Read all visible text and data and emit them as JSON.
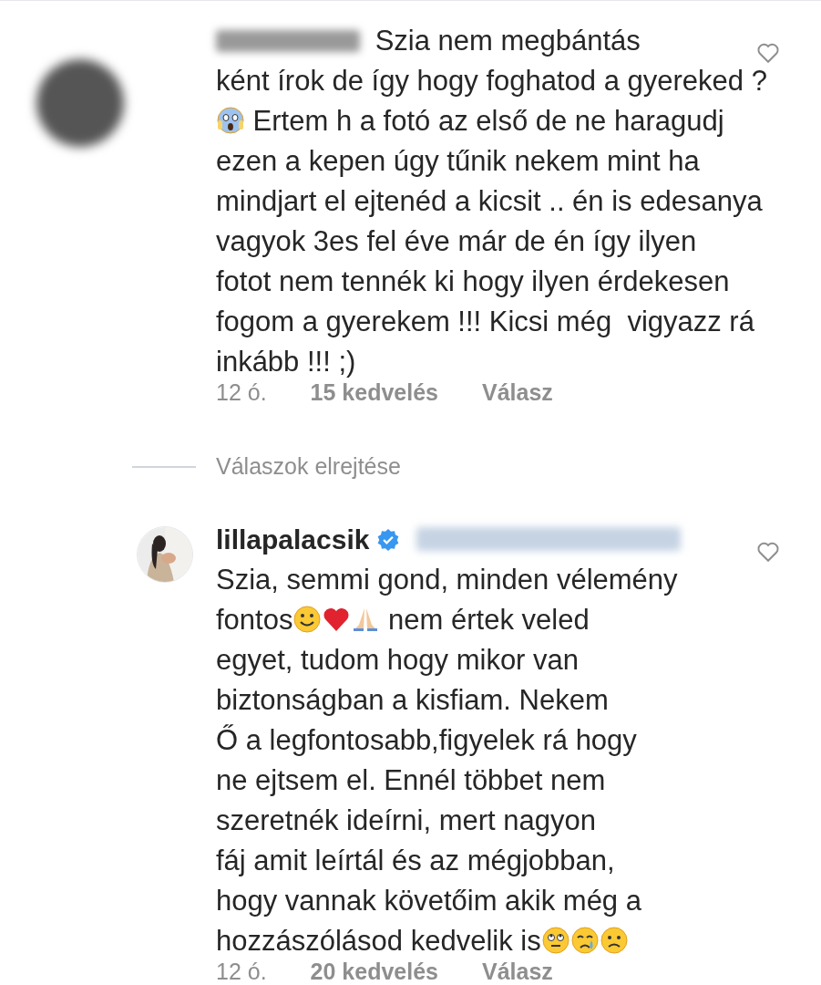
{
  "comments": [
    {
      "avatar_blurred": true,
      "username_blurred": true,
      "verified": false,
      "mention_blurred": false,
      "liked": false,
      "body": [
        {
          "kind": "text",
          "text": "Szia nem megbántás\nként írok de így hogy foghatod a gyereked ?\n"
        },
        {
          "kind": "scream-emoji"
        },
        {
          "kind": "text",
          "text": " Ertem h a fotó az első de ne haragudj\nezen a kepen úgy tűnik nekem mint ha\nmindjart el ejtenéd a kicsit .. én is edesanya\nvagyok 3es fel éve már de én így ilyen\nfotot nem tennék ki hogy ilyen érdekesen\nfogom a gyerekem !!! Kicsi még  vigyazz rá\ninkább !!! ;)"
        }
      ],
      "time": "12 ó.",
      "likes": "15 kedvelés",
      "reply": "Válasz"
    },
    {
      "hide_replies": "Válaszok elrejtése"
    },
    {
      "avatar_blurred": false,
      "username": "lillapalacsik",
      "verified": true,
      "mention_blurred": true,
      "liked": false,
      "body": [
        {
          "kind": "text",
          "text": "Szia, semmi gond, minden vélemény\nfontos"
        },
        {
          "kind": "smile-emoji"
        },
        {
          "kind": "heart-emoji"
        },
        {
          "kind": "pray-emoji"
        },
        {
          "kind": "text",
          "text": " nem értek veled\negyet, tudom hogy mikor van\nbiztonságban a kisfiam. Nekem\nŐ a legfontosabb,figyelek rá hogy\nne ejtsem el. Ennél többet nem\nszeretnék ideírni, mert nagyon\nfáj amit leírtál és az mégjobban,\nhogy vannak követőim akik még a\nhozzászólásod kedvelik is"
        },
        {
          "kind": "eyeroll-emoji"
        },
        {
          "kind": "cry-emoji"
        },
        {
          "kind": "sad-emoji"
        }
      ],
      "time": "12 ó.",
      "likes": "20 kedvelés",
      "reply": "Válasz"
    }
  ]
}
